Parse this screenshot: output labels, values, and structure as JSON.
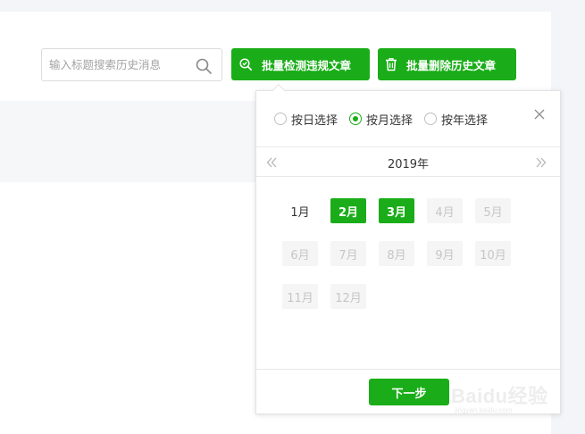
{
  "search": {
    "placeholder": "输入标题搜索历史消息",
    "icon": "search-icon"
  },
  "toolbar": {
    "detect_label": "批量检测违规文章",
    "detect_icon": "scan-magnify-icon",
    "delete_label": "批量删除历史文章",
    "delete_icon": "trash-icon"
  },
  "picker": {
    "modes": [
      {
        "label": "按日选择",
        "checked": false
      },
      {
        "label": "按月选择",
        "checked": true
      },
      {
        "label": "按年选择",
        "checked": false
      }
    ],
    "year": "2019年",
    "months": [
      {
        "label": "1月",
        "state": "normal"
      },
      {
        "label": "2月",
        "state": "selected"
      },
      {
        "label": "3月",
        "state": "selected"
      },
      {
        "label": "4月",
        "state": "disabled"
      },
      {
        "label": "5月",
        "state": "disabled"
      },
      {
        "label": "6月",
        "state": "disabled"
      },
      {
        "label": "7月",
        "state": "disabled"
      },
      {
        "label": "8月",
        "state": "disabled"
      },
      {
        "label": "9月",
        "state": "disabled"
      },
      {
        "label": "10月",
        "state": "disabled"
      },
      {
        "label": "11月",
        "state": "disabled"
      },
      {
        "label": "12月",
        "state": "disabled"
      }
    ],
    "next_label": "下一步"
  },
  "watermark": {
    "main": "Baidu经验",
    "sub": "jingyan.baidu.com"
  },
  "colors": {
    "accent": "#1aad19",
    "disabled_bg": "#f5f5f5",
    "disabled_text": "#c6c6c6"
  }
}
